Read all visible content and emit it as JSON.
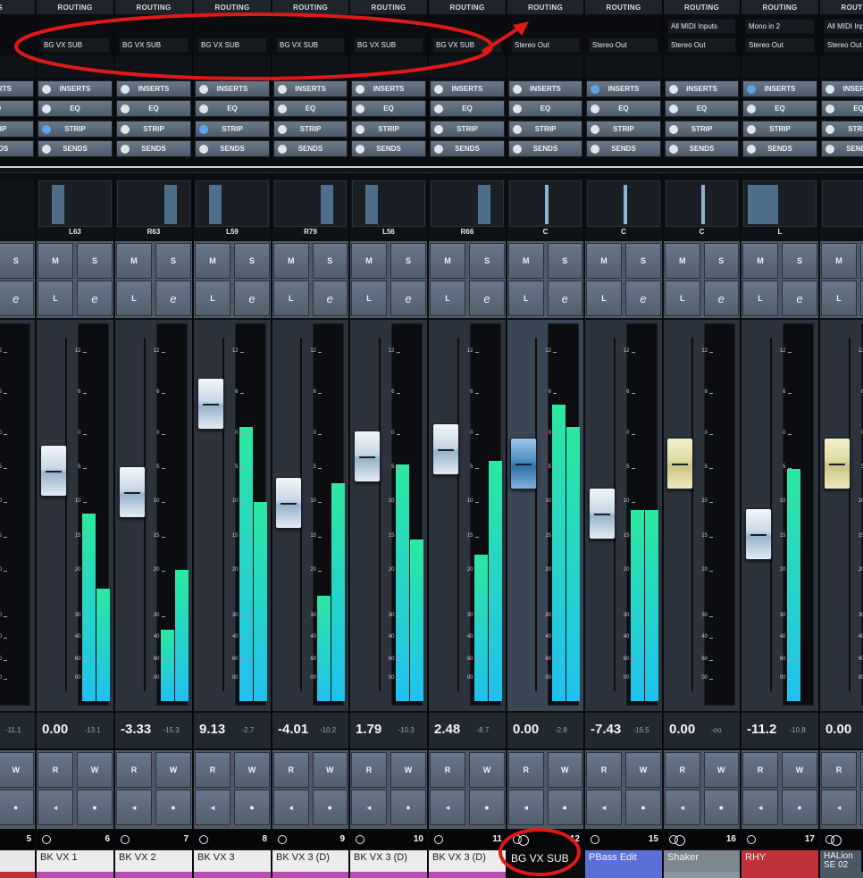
{
  "section_buttons": {
    "inserts": "INSERTS",
    "eq": "EQ",
    "strip": "STRIP",
    "sends": "SENDS"
  },
  "button_labels": {
    "mute": "M",
    "solo": "S",
    "listen": "L",
    "edit": "e",
    "read": "R",
    "write": "W"
  },
  "scale_ticks": [
    "12",
    "6",
    "0",
    "5",
    "10",
    "15",
    "20",
    "30",
    "40",
    "60",
    "00"
  ],
  "colors": {
    "meter_top": "#2ce8a0",
    "meter_bottom": "#20c0ee",
    "led_on": "#5ea4ea",
    "annotation": "#e01818"
  },
  "channels": [
    {
      "routing": "ING",
      "route_in": "",
      "route_out": "",
      "pan": "",
      "level": "",
      "peak": "-11.1",
      "number": "5",
      "name": "r",
      "name_color": "#e8e8e8",
      "strip_color": "#c2303a",
      "ring": "none",
      "fader": "none",
      "meters": [
        0,
        0
      ],
      "leds": [
        false,
        false,
        true,
        false
      ]
    },
    {
      "routing": "ROUTING",
      "route_in": "",
      "route_out": "BG VX SUB",
      "pan": "L63",
      "level": "0.00",
      "peak": "-13.1",
      "number": "6",
      "name": "BK VX 1",
      "name_color": "#ececec",
      "strip_color": "#b84fb0",
      "ring": "single",
      "fader": "white",
      "fader_pos": 0.25,
      "meters": [
        0.5,
        0.3
      ],
      "leds": [
        false,
        false,
        true,
        false
      ]
    },
    {
      "routing": "ROUTING",
      "route_in": "",
      "route_out": "BG VX SUB",
      "pan": "R63",
      "level": "-3.33",
      "peak": "-15.3",
      "number": "7",
      "name": "BK VX 2",
      "name_color": "#ececec",
      "strip_color": "#b84fb0",
      "ring": "single",
      "fader": "white",
      "fader_pos": 0.31,
      "meters": [
        0.19,
        0.35
      ],
      "leds": [
        false,
        false,
        false,
        false
      ]
    },
    {
      "routing": "ROUTING",
      "route_in": "",
      "route_out": "BG VX SUB",
      "pan": "L59",
      "level": "9.13",
      "peak": "-2.7",
      "number": "8",
      "name": "BK VX 3",
      "name_color": "#ececec",
      "strip_color": "#b84fb0",
      "ring": "single",
      "fader": "white",
      "fader_pos": 0.06,
      "meters": [
        0.73,
        0.53
      ],
      "leds": [
        false,
        false,
        true,
        false
      ]
    },
    {
      "routing": "ROUTING",
      "route_in": "",
      "route_out": "BG VX SUB",
      "pan": "R79",
      "level": "-4.01",
      "peak": "-10.2",
      "number": "9",
      "name": "BK VX 3 (D)",
      "name_color": "#ececec",
      "strip_color": "#b84fb0",
      "ring": "single",
      "fader": "white",
      "fader_pos": 0.34,
      "meters": [
        0.28,
        0.58
      ],
      "leds": [
        false,
        false,
        false,
        false
      ]
    },
    {
      "routing": "ROUTING",
      "route_in": "",
      "route_out": "BG VX SUB",
      "pan": "L56",
      "level": "1.79",
      "peak": "-10.3",
      "number": "10",
      "name": "BK VX 3 (D)",
      "name_color": "#ececec",
      "strip_color": "#b84fb0",
      "ring": "single",
      "fader": "white",
      "fader_pos": 0.21,
      "meters": [
        0.63,
        0.43
      ],
      "leds": [
        false,
        false,
        false,
        false
      ]
    },
    {
      "routing": "ROUTING",
      "route_in": "",
      "route_out": "BG VX SUB",
      "pan": "R66",
      "level": "2.48",
      "peak": "-8.7",
      "number": "11",
      "name": "BK VX 3 (D)",
      "name_color": "#ececec",
      "strip_color": "#b84fb0",
      "ring": "single",
      "fader": "white",
      "fader_pos": 0.19,
      "meters": [
        0.39,
        0.64
      ],
      "leds": [
        false,
        false,
        false,
        false
      ]
    },
    {
      "routing": "ROUTING",
      "route_in": "",
      "route_out": "Stereo Out",
      "pan": "C",
      "level": "0.00",
      "peak": "-2.8",
      "number": "12",
      "name": "BG VX SUB",
      "name_color": "#0b0b0b",
      "strip_color": "#0b0b0b",
      "ring": "dual",
      "fader": "blue",
      "fader_pos": 0.23,
      "meters": [
        0.79,
        0.73
      ],
      "leds": [
        false,
        false,
        false,
        false
      ],
      "selected": true
    },
    {
      "routing": "ROUTING",
      "route_in": "",
      "route_out": "Stereo Out",
      "pan": "C",
      "level": "-7.43",
      "peak": "-16.5",
      "number": "15",
      "name": "PBass Edit",
      "name_color": "#5b6fd6",
      "strip_color": "#5b6fd6",
      "ring": "single",
      "fader": "white",
      "fader_pos": 0.37,
      "meters": [
        0.51,
        0.51
      ],
      "leds": [
        true,
        false,
        false,
        false
      ]
    },
    {
      "routing": "ROUTING",
      "route_in": "All MIDI Inputs",
      "route_out": "Stereo Out",
      "pan": "C",
      "level": "0.00",
      "peak": "-oo",
      "number": "16",
      "name": "Shaker",
      "name_color": "#7c8790",
      "strip_color": "#8c969e",
      "ring": "dual",
      "fader": "yellow",
      "fader_pos": 0.23,
      "meters": [
        0,
        0
      ],
      "leds": [
        false,
        false,
        false,
        false
      ]
    },
    {
      "routing": "ROUTING",
      "route_in": "Mono in 2",
      "route_out": "Stereo Out",
      "pan": "L",
      "level": "-11.2",
      "peak": "-10.8",
      "number": "17",
      "name": "RHY",
      "name_color": "#c2303a",
      "strip_color": "#c2303a",
      "ring": "single",
      "fader": "white",
      "fader_pos": 0.43,
      "meters": [
        0.62
      ],
      "leds": [
        true,
        false,
        false,
        false
      ]
    },
    {
      "routing": "ROUTING",
      "route_in": "All MIDI Inp",
      "route_out": "Stereo Out",
      "pan": "",
      "level": "0.00",
      "peak": "",
      "number": "",
      "name": "HALion SE 02",
      "name_color": "#4c5864",
      "strip_color": "#4c5864",
      "ring": "dual",
      "fader": "yellow",
      "fader_pos": 0.23,
      "meters": [],
      "leds": [
        false,
        false,
        false,
        false
      ]
    }
  ]
}
